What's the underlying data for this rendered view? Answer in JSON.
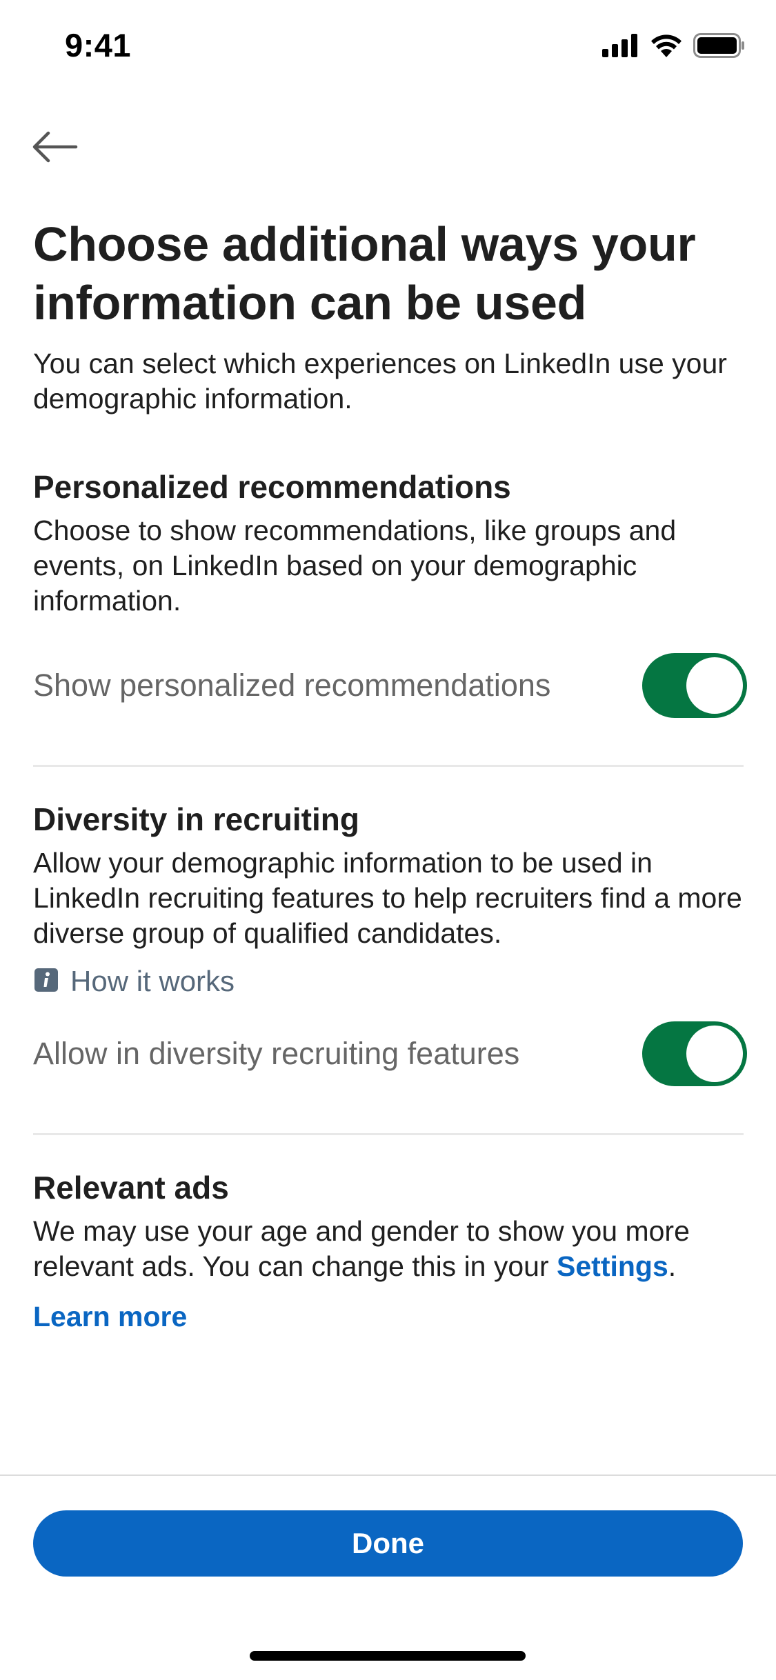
{
  "status_bar": {
    "time": "9:41",
    "icons": [
      "cellular-signal-icon",
      "wifi-icon",
      "battery-icon"
    ]
  },
  "header": {
    "back_icon": "arrow-left-icon"
  },
  "page": {
    "title": "Choose additional ways your information can be used",
    "subtitle": "You can select which experiences on LinkedIn use your demographic information."
  },
  "sections": {
    "personalized": {
      "heading": "Personalized recommendations",
      "description": "Choose to show recommendations, like groups and events, on LinkedIn based on your demographic information.",
      "toggle_label": "Show personalized recommendations",
      "toggle_on": true
    },
    "diversity": {
      "heading": "Diversity in recruiting",
      "description": "Allow your demographic information to be used in LinkedIn recruiting features to help recruiters find a more diverse group of qualified candidates.",
      "how_it_works_label": "How it works",
      "how_it_works_icon": "info-icon",
      "toggle_label": "Allow in diversity recruiting features",
      "toggle_on": true
    },
    "ads": {
      "heading": "Relevant ads",
      "description_prefix": "We may use your age and gender to show you more relevant ads. You can change this in your ",
      "settings_link": "Settings",
      "description_suffix": ".",
      "learn_more": "Learn more"
    }
  },
  "footer": {
    "done_label": "Done"
  },
  "colors": {
    "accent": "#0a66c2",
    "toggle_on": "#057642",
    "muted_text": "#666666",
    "info_text": "#56687a",
    "divider": "#e8e8e8"
  }
}
